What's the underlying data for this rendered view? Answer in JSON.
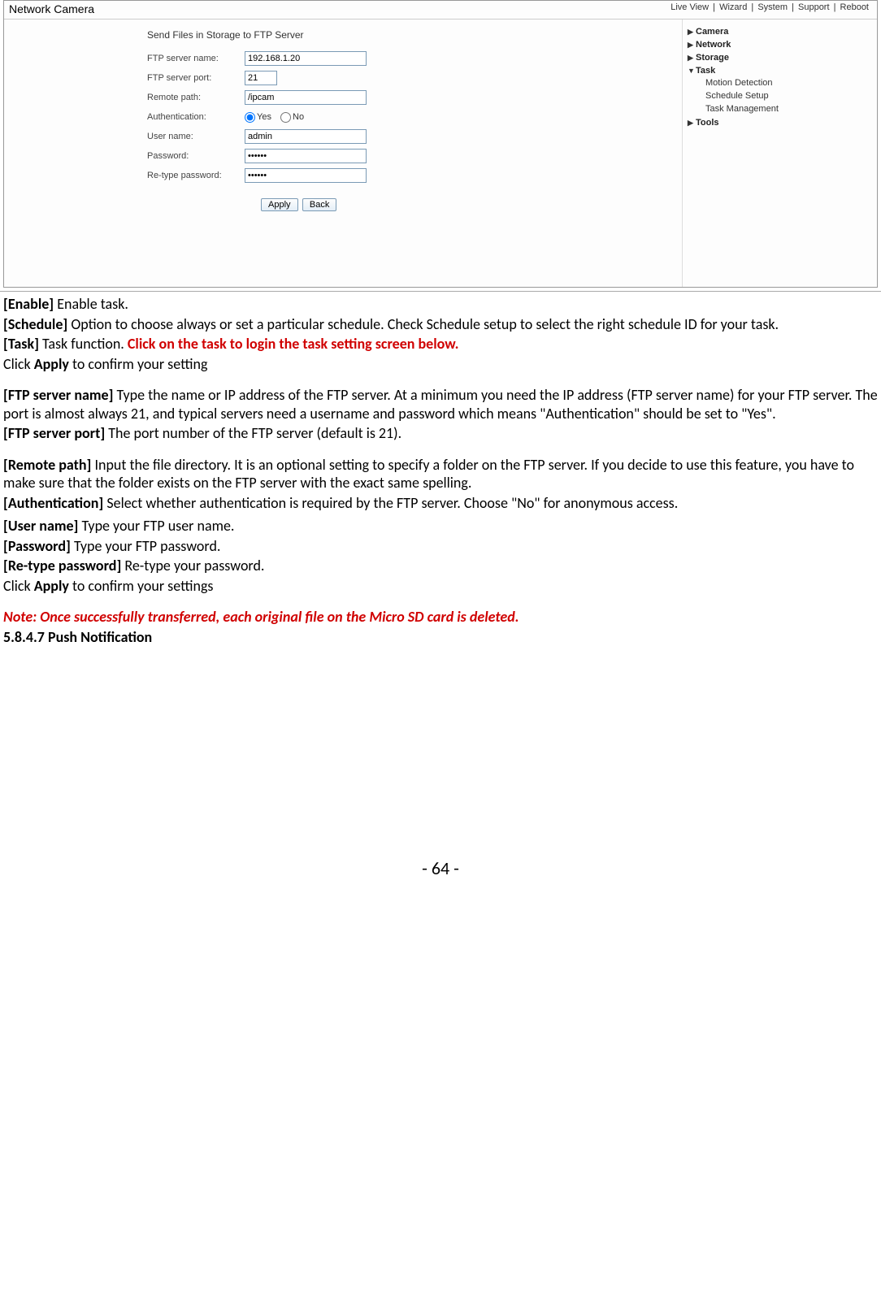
{
  "shot": {
    "title": "Network Camera",
    "topnav": [
      "Live View",
      "Wizard",
      "System",
      "Support",
      "Reboot"
    ],
    "formTitle": "Send Files in Storage to FTP Server",
    "labels": {
      "serverName": "FTP server name:",
      "serverPort": "FTP server port:",
      "remotePath": "Remote path:",
      "auth": "Authentication:",
      "user": "User name:",
      "pass": "Password:",
      "repass": "Re-type password:"
    },
    "values": {
      "serverName": "192.168.1.20",
      "serverPort": "21",
      "remotePath": "/ipcam",
      "user": "admin",
      "pass": "••••••",
      "repass": "••••••"
    },
    "radio": {
      "yes": "Yes",
      "no": "No"
    },
    "buttons": {
      "apply": "Apply",
      "back": "Back"
    },
    "side": {
      "camera": "Camera",
      "network": "Network",
      "storage": "Storage",
      "task": "Task",
      "taskSub": [
        "Motion Detection",
        "Schedule Setup",
        "Task Management"
      ],
      "tools": "Tools"
    }
  },
  "doc": {
    "p1a": "[Enable] ",
    "p1b": "Enable task.",
    "p2a": "[Schedule] ",
    "p2b": "Option to choose always or set a particular schedule. Check Schedule setup to select the right schedule ID for your task.",
    "p3a": "[Task] ",
    "p3b": "Task function. ",
    "p3c": "Click on the task to login the task setting screen below.",
    "p4a": "Click ",
    "p4b": "Apply",
    "p4c": " to confirm your setting",
    "p5a": "[FTP server name] ",
    "p5b": "Type the name or IP address of the FTP server. At a minimum you need the IP address (FTP server name) for your FTP server. The port is almost always 21, and typical servers need a username and password which means \"Authentication\" should be set to \"Yes\".",
    "p6a": "[FTP server port] ",
    "p6b": "The port number of the FTP server (default is 21).",
    "p7a": "[Remote path] ",
    "p7b": "Input the file directory. It is an optional setting to specify a folder on the FTP server. If you decide to use this feature, you have to make sure that the folder exists on the FTP server with the exact same spelling.",
    "p8a": "[Authentication] ",
    "p8b": "Select whether authentication is required by the FTP server. Choose \"No\" for anonymous access.",
    "p9a": "[User name] ",
    "p9b": "Type your FTP user name.",
    "p10a": "[Password] ",
    "p10b": "Type your FTP password.",
    "p11a": "[Re-type password] ",
    "p11b": "Re-type your password.",
    "p12a": "Click ",
    "p12b": "Apply",
    "p12c": " to confirm your settings",
    "note": "Note: Once successfully transferred, each original file on the Micro SD card is deleted.",
    "section": "5.8.4.7 Push Notification",
    "pagenum": "- 64 -"
  }
}
